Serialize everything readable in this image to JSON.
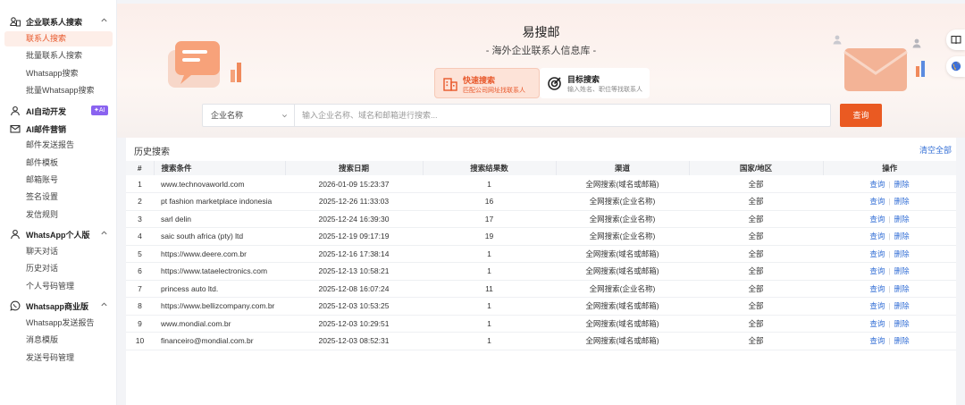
{
  "sidebar": {
    "sections": [
      {
        "title": "企业联系人搜索",
        "icon": "contacts-icon",
        "items": [
          "联系人搜索",
          "批量联系人搜索",
          "Whatsapp搜索",
          "批量Whatsapp搜索"
        ]
      },
      {
        "title": "AI自动开发",
        "icon": "person-icon",
        "badge": "AI",
        "items": []
      },
      {
        "title": "AI邮件营销",
        "icon": "mail-icon",
        "items": [
          "邮件发送报告",
          "邮件模板",
          "邮箱账号",
          "签名设置",
          "发信规则"
        ]
      },
      {
        "title": "WhatsApp个人版",
        "icon": "person-icon",
        "items": [
          "聊天对话",
          "历史对话",
          "个人号码管理"
        ]
      },
      {
        "title": "Whatsapp商业版",
        "icon": "whatsapp-icon",
        "items": [
          "Whatsapp发送报告",
          "消息模版",
          "发送号码管理"
        ]
      }
    ],
    "active_item": "联系人搜索"
  },
  "hero": {
    "title": "易搜邮",
    "subtitle": "- 海外企业联系人信息库 -",
    "modes": [
      {
        "title": "快速搜索",
        "desc": "匹配公司网址找联系人"
      },
      {
        "title": "目标搜索",
        "desc": "输入姓名、职位等找联系人"
      }
    ]
  },
  "search": {
    "select_value": "企业名称",
    "placeholder": "输入企业名称、域名和邮箱进行搜索...",
    "button": "查询"
  },
  "history": {
    "title": "历史搜索",
    "clear_all": "清空全部",
    "columns": [
      "#",
      "搜索条件",
      "搜索日期",
      "搜索结果数",
      "渠道",
      "国家/地区",
      "操作"
    ],
    "action_query": "查询",
    "action_delete": "删除",
    "rows": [
      {
        "no": "1",
        "query": "www.technovaworld.com",
        "date": "2026-01-09 15:23:37",
        "count": "1",
        "channel": "全网搜索(域名或邮箱)",
        "region": "全部"
      },
      {
        "no": "2",
        "query": "pt fashion marketplace indonesia",
        "date": "2025-12-26 11:33:03",
        "count": "16",
        "channel": "全网搜索(企业名称)",
        "region": "全部"
      },
      {
        "no": "3",
        "query": "sarl delin",
        "date": "2025-12-24 16:39:30",
        "count": "17",
        "channel": "全网搜索(企业名称)",
        "region": "全部"
      },
      {
        "no": "4",
        "query": "saic south africa (pty) ltd",
        "date": "2025-12-19 09:17:19",
        "count": "19",
        "channel": "全网搜索(企业名称)",
        "region": "全部"
      },
      {
        "no": "5",
        "query": "https://www.deere.com.br",
        "date": "2025-12-16 17:38:14",
        "count": "1",
        "channel": "全网搜索(域名或邮箱)",
        "region": "全部"
      },
      {
        "no": "6",
        "query": "https://www.tataelectronics.com",
        "date": "2025-12-13 10:58:21",
        "count": "1",
        "channel": "全网搜索(域名或邮箱)",
        "region": "全部"
      },
      {
        "no": "7",
        "query": "princess auto ltd.",
        "date": "2025-12-08 16:07:24",
        "count": "11",
        "channel": "全网搜索(企业名称)",
        "region": "全部"
      },
      {
        "no": "8",
        "query": "https://www.bellizcompany.com.br",
        "date": "2025-12-03 10:53:25",
        "count": "1",
        "channel": "全网搜索(域名或邮箱)",
        "region": "全部"
      },
      {
        "no": "9",
        "query": "www.mondial.com.br",
        "date": "2025-12-03 10:29:51",
        "count": "1",
        "channel": "全网搜索(域名或邮箱)",
        "region": "全部"
      },
      {
        "no": "10",
        "query": "financeiro@mondial.com.br",
        "date": "2025-12-03 08:52:31",
        "count": "1",
        "channel": "全网搜索(域名或邮箱)",
        "region": "全部"
      }
    ]
  },
  "colors": {
    "accent": "#ea5a22",
    "link": "#3570d6",
    "ai_badge": "#8a63f0"
  }
}
